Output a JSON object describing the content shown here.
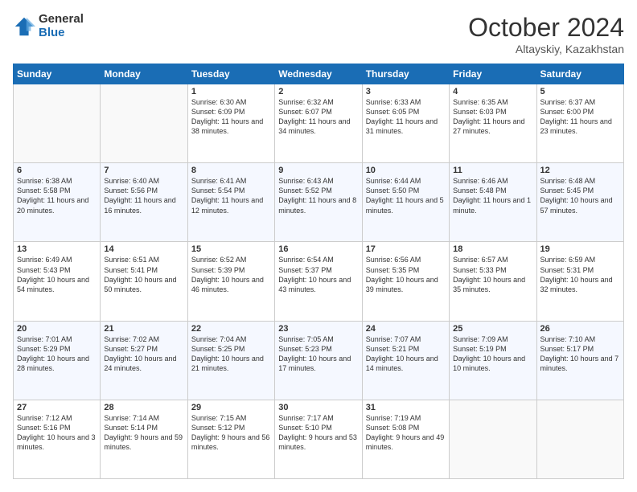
{
  "logo": {
    "general": "General",
    "blue": "Blue"
  },
  "header": {
    "month": "October 2024",
    "location": "Altayskiy, Kazakhstan"
  },
  "weekdays": [
    "Sunday",
    "Monday",
    "Tuesday",
    "Wednesday",
    "Thursday",
    "Friday",
    "Saturday"
  ],
  "weeks": [
    [
      {
        "day": "",
        "info": ""
      },
      {
        "day": "",
        "info": ""
      },
      {
        "day": "1",
        "info": "Sunrise: 6:30 AM\nSunset: 6:09 PM\nDaylight: 11 hours and 38 minutes."
      },
      {
        "day": "2",
        "info": "Sunrise: 6:32 AM\nSunset: 6:07 PM\nDaylight: 11 hours and 34 minutes."
      },
      {
        "day": "3",
        "info": "Sunrise: 6:33 AM\nSunset: 6:05 PM\nDaylight: 11 hours and 31 minutes."
      },
      {
        "day": "4",
        "info": "Sunrise: 6:35 AM\nSunset: 6:03 PM\nDaylight: 11 hours and 27 minutes."
      },
      {
        "day": "5",
        "info": "Sunrise: 6:37 AM\nSunset: 6:00 PM\nDaylight: 11 hours and 23 minutes."
      }
    ],
    [
      {
        "day": "6",
        "info": "Sunrise: 6:38 AM\nSunset: 5:58 PM\nDaylight: 11 hours and 20 minutes."
      },
      {
        "day": "7",
        "info": "Sunrise: 6:40 AM\nSunset: 5:56 PM\nDaylight: 11 hours and 16 minutes."
      },
      {
        "day": "8",
        "info": "Sunrise: 6:41 AM\nSunset: 5:54 PM\nDaylight: 11 hours and 12 minutes."
      },
      {
        "day": "9",
        "info": "Sunrise: 6:43 AM\nSunset: 5:52 PM\nDaylight: 11 hours and 8 minutes."
      },
      {
        "day": "10",
        "info": "Sunrise: 6:44 AM\nSunset: 5:50 PM\nDaylight: 11 hours and 5 minutes."
      },
      {
        "day": "11",
        "info": "Sunrise: 6:46 AM\nSunset: 5:48 PM\nDaylight: 11 hours and 1 minute."
      },
      {
        "day": "12",
        "info": "Sunrise: 6:48 AM\nSunset: 5:45 PM\nDaylight: 10 hours and 57 minutes."
      }
    ],
    [
      {
        "day": "13",
        "info": "Sunrise: 6:49 AM\nSunset: 5:43 PM\nDaylight: 10 hours and 54 minutes."
      },
      {
        "day": "14",
        "info": "Sunrise: 6:51 AM\nSunset: 5:41 PM\nDaylight: 10 hours and 50 minutes."
      },
      {
        "day": "15",
        "info": "Sunrise: 6:52 AM\nSunset: 5:39 PM\nDaylight: 10 hours and 46 minutes."
      },
      {
        "day": "16",
        "info": "Sunrise: 6:54 AM\nSunset: 5:37 PM\nDaylight: 10 hours and 43 minutes."
      },
      {
        "day": "17",
        "info": "Sunrise: 6:56 AM\nSunset: 5:35 PM\nDaylight: 10 hours and 39 minutes."
      },
      {
        "day": "18",
        "info": "Sunrise: 6:57 AM\nSunset: 5:33 PM\nDaylight: 10 hours and 35 minutes."
      },
      {
        "day": "19",
        "info": "Sunrise: 6:59 AM\nSunset: 5:31 PM\nDaylight: 10 hours and 32 minutes."
      }
    ],
    [
      {
        "day": "20",
        "info": "Sunrise: 7:01 AM\nSunset: 5:29 PM\nDaylight: 10 hours and 28 minutes."
      },
      {
        "day": "21",
        "info": "Sunrise: 7:02 AM\nSunset: 5:27 PM\nDaylight: 10 hours and 24 minutes."
      },
      {
        "day": "22",
        "info": "Sunrise: 7:04 AM\nSunset: 5:25 PM\nDaylight: 10 hours and 21 minutes."
      },
      {
        "day": "23",
        "info": "Sunrise: 7:05 AM\nSunset: 5:23 PM\nDaylight: 10 hours and 17 minutes."
      },
      {
        "day": "24",
        "info": "Sunrise: 7:07 AM\nSunset: 5:21 PM\nDaylight: 10 hours and 14 minutes."
      },
      {
        "day": "25",
        "info": "Sunrise: 7:09 AM\nSunset: 5:19 PM\nDaylight: 10 hours and 10 minutes."
      },
      {
        "day": "26",
        "info": "Sunrise: 7:10 AM\nSunset: 5:17 PM\nDaylight: 10 hours and 7 minutes."
      }
    ],
    [
      {
        "day": "27",
        "info": "Sunrise: 7:12 AM\nSunset: 5:16 PM\nDaylight: 10 hours and 3 minutes."
      },
      {
        "day": "28",
        "info": "Sunrise: 7:14 AM\nSunset: 5:14 PM\nDaylight: 9 hours and 59 minutes."
      },
      {
        "day": "29",
        "info": "Sunrise: 7:15 AM\nSunset: 5:12 PM\nDaylight: 9 hours and 56 minutes."
      },
      {
        "day": "30",
        "info": "Sunrise: 7:17 AM\nSunset: 5:10 PM\nDaylight: 9 hours and 53 minutes."
      },
      {
        "day": "31",
        "info": "Sunrise: 7:19 AM\nSunset: 5:08 PM\nDaylight: 9 hours and 49 minutes."
      },
      {
        "day": "",
        "info": ""
      },
      {
        "day": "",
        "info": ""
      }
    ]
  ]
}
